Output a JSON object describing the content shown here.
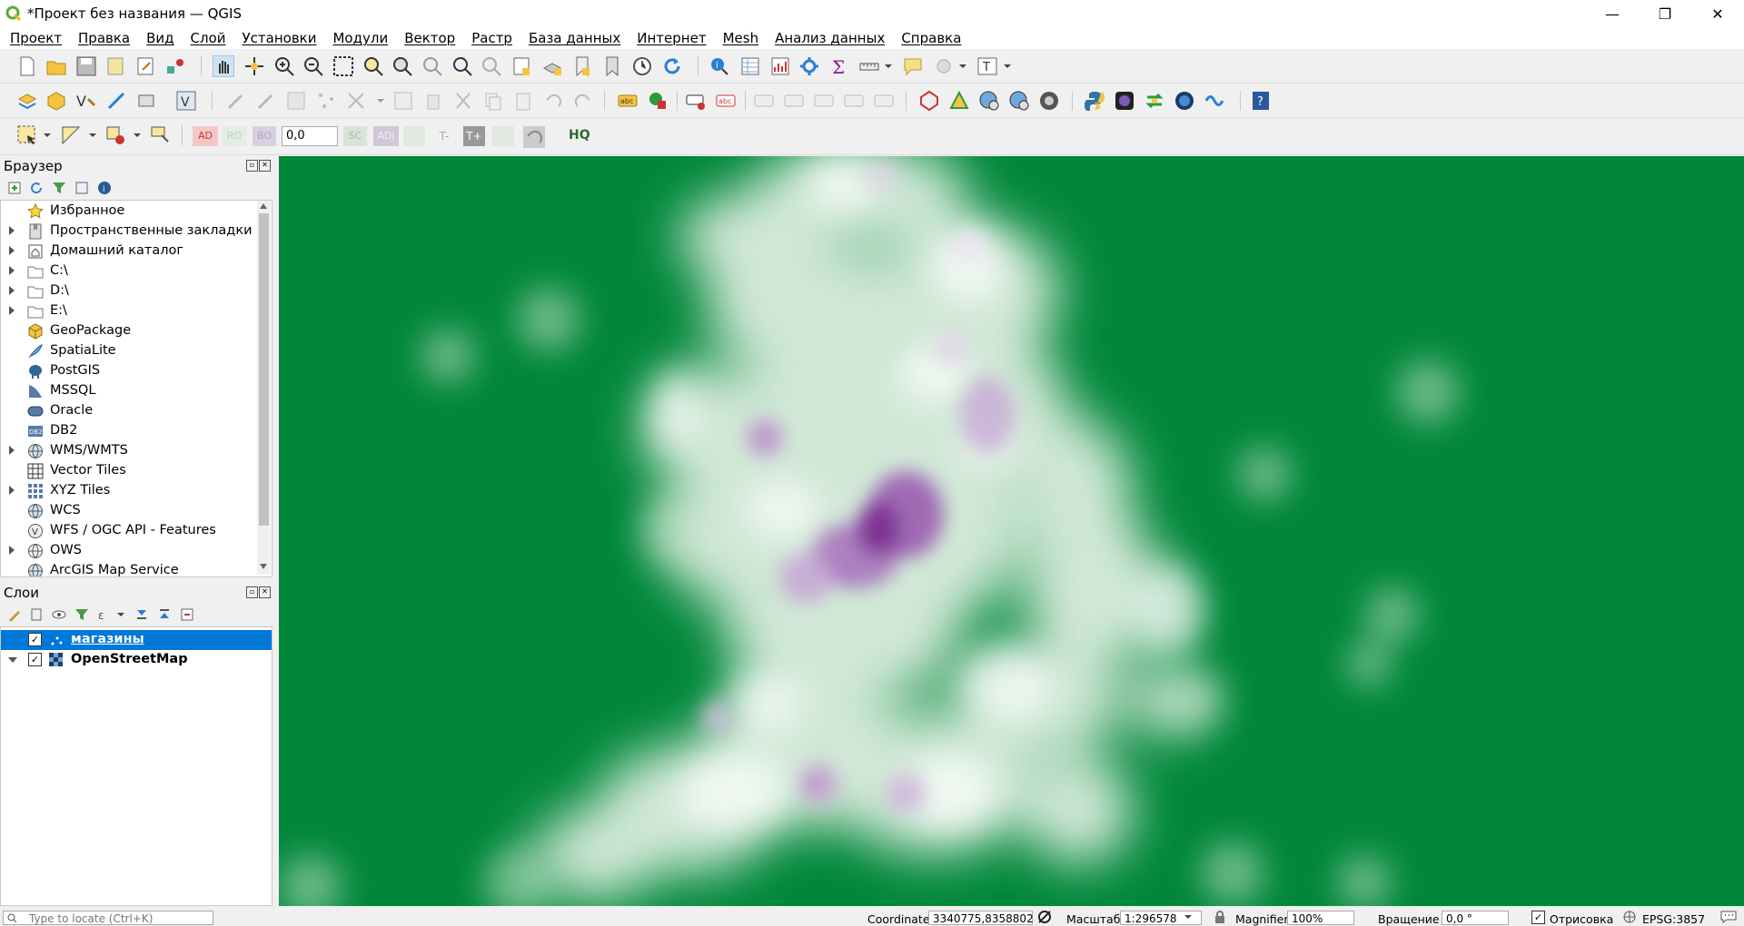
{
  "window": {
    "title": "*Проект без названия — QGIS",
    "controls": {
      "minimize": "—",
      "maximize": "❐",
      "close": "✕"
    }
  },
  "menu": [
    "Проект",
    "Правка",
    "Вид",
    "Слой",
    "Установки",
    "Модули",
    "Вектор",
    "Растр",
    "База данных",
    "Интернет",
    "Mesh",
    "Анализ данных",
    "Справка"
  ],
  "digitizing": {
    "label_ad": "AD",
    "label_ro": "RO",
    "label_bo": "BO",
    "spin_value": "0,0",
    "label_sc": "SC",
    "label_adj": "ADJ",
    "label_tminus": "T-",
    "label_tplus": "T+",
    "hq": "HQ"
  },
  "browser": {
    "title": "Браузер",
    "items": [
      {
        "label": "Избранное",
        "icon": "star-icon",
        "expandable": false
      },
      {
        "label": "Пространственные закладки",
        "icon": "bookmark-icon",
        "expandable": true
      },
      {
        "label": "Домашний каталог",
        "icon": "home-icon",
        "expandable": true
      },
      {
        "label": "C:\\",
        "icon": "folder-icon",
        "expandable": true
      },
      {
        "label": "D:\\",
        "icon": "folder-icon",
        "expandable": true
      },
      {
        "label": "E:\\",
        "icon": "folder-icon",
        "expandable": true
      },
      {
        "label": "GeoPackage",
        "icon": "geopackage-icon",
        "expandable": false
      },
      {
        "label": "SpatiaLite",
        "icon": "feather-icon",
        "expandable": false
      },
      {
        "label": "PostGIS",
        "icon": "elephant-icon",
        "expandable": false
      },
      {
        "label": "MSSQL",
        "icon": "mssql-icon",
        "expandable": false
      },
      {
        "label": "Oracle",
        "icon": "oracle-icon",
        "expandable": false
      },
      {
        "label": "DB2",
        "icon": "db2-icon",
        "expandable": false
      },
      {
        "label": "WMS/WMTS",
        "icon": "globe-icon",
        "expandable": true
      },
      {
        "label": "Vector Tiles",
        "icon": "grid-icon",
        "expandable": false
      },
      {
        "label": "XYZ Tiles",
        "icon": "tiles-icon",
        "expandable": true
      },
      {
        "label": "WCS",
        "icon": "globe-icon",
        "expandable": false
      },
      {
        "label": "WFS / OGC API - Features",
        "icon": "wfs-icon",
        "expandable": false
      },
      {
        "label": "OWS",
        "icon": "globe-icon",
        "expandable": true
      },
      {
        "label": "ArcGIS Map Service",
        "icon": "globe-icon",
        "expandable": false
      }
    ]
  },
  "layers": {
    "title": "Слои",
    "items": [
      {
        "label": "магазины",
        "checked": true,
        "selected": true
      },
      {
        "label": "OpenStreetMap",
        "checked": true,
        "selected": false
      }
    ]
  },
  "status": {
    "locate_placeholder": "Type to locate (Ctrl+K)",
    "coordinate_label": "Coordinate",
    "coordinate_value": "3340775,8358802",
    "scale_label": "Масштаб",
    "scale_value": "1:296578",
    "magnifier_label": "Magnifier",
    "magnifier_value": "100%",
    "rotation_label": "Вращение",
    "rotation_value": "0,0 °",
    "render_label": "Отрисовка",
    "crs": "EPSG:3857"
  },
  "colors": {
    "map_background": "#00873a",
    "heat_mid": "#e6f2e6",
    "heat_high": "#7b2d8f",
    "selection": "#0078d7"
  }
}
